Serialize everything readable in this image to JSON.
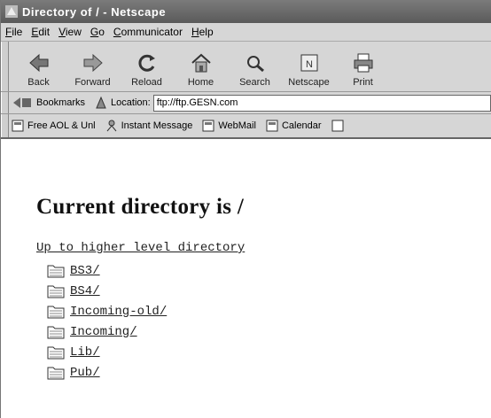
{
  "window": {
    "title": "Directory of / - Netscape"
  },
  "menu": [
    "File",
    "Edit",
    "View",
    "Go",
    "Communicator",
    "Help"
  ],
  "toolbar": [
    {
      "label": "Back",
      "icon": "back-icon"
    },
    {
      "label": "Forward",
      "icon": "forward-icon"
    },
    {
      "label": "Reload",
      "icon": "reload-icon"
    },
    {
      "label": "Home",
      "icon": "home-icon"
    },
    {
      "label": "Search",
      "icon": "search-icon"
    },
    {
      "label": "Netscape",
      "icon": "netscape-icon"
    },
    {
      "label": "Print",
      "icon": "print-icon"
    }
  ],
  "location": {
    "bookmarks_label": "Bookmarks",
    "location_label": "Location:",
    "url": "ftp://ftp.GESN.com"
  },
  "personal": [
    "Free AOL & Unl",
    "Instant Message",
    "WebMail",
    "Calendar"
  ],
  "content": {
    "heading": "Current directory is /",
    "up_link": "Up to higher level directory",
    "dirs": [
      "BS3/",
      "BS4/",
      "Incoming-old/",
      "Incoming/",
      "Lib/",
      "Pub/"
    ]
  }
}
